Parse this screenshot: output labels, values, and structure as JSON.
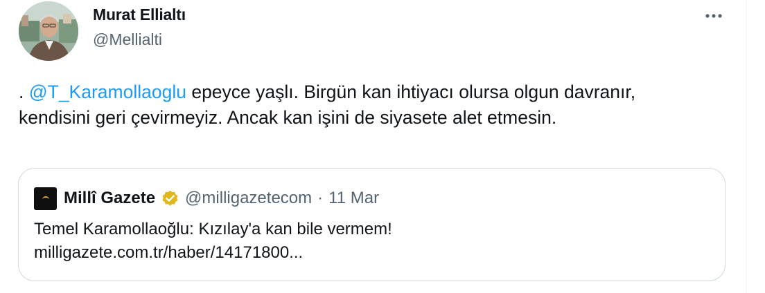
{
  "author": {
    "display_name": "Murat Ellialtı",
    "handle": "@Mellialti"
  },
  "icons": {
    "more": "more-horizontal-icon",
    "verified": "verified-gold-badge-icon"
  },
  "tweet": {
    "prefix": ". ",
    "mention": "@T_Karamollaoglu",
    "body": " epeyce yaşlı. Birgün kan ihtiyacı olursa olgun davranır, kendisini geri çevirmeyiz. Ancak kan işini de siyasete alet etmesin."
  },
  "quote": {
    "display_name": "Millî Gazete",
    "handle": "@milligazetecom",
    "separator": "·",
    "date": "11 Mar",
    "text_line1": "Temel Karamollaoğlu: Kızılay'a kan bile vermem!",
    "text_line2": "milligazete.com.tr/haber/14171800..."
  },
  "colors": {
    "text": "#0f1419",
    "secondary": "#536471",
    "link": "#1d9bf0",
    "border": "#cfd9de",
    "verified_gold": "#e2b719"
  }
}
